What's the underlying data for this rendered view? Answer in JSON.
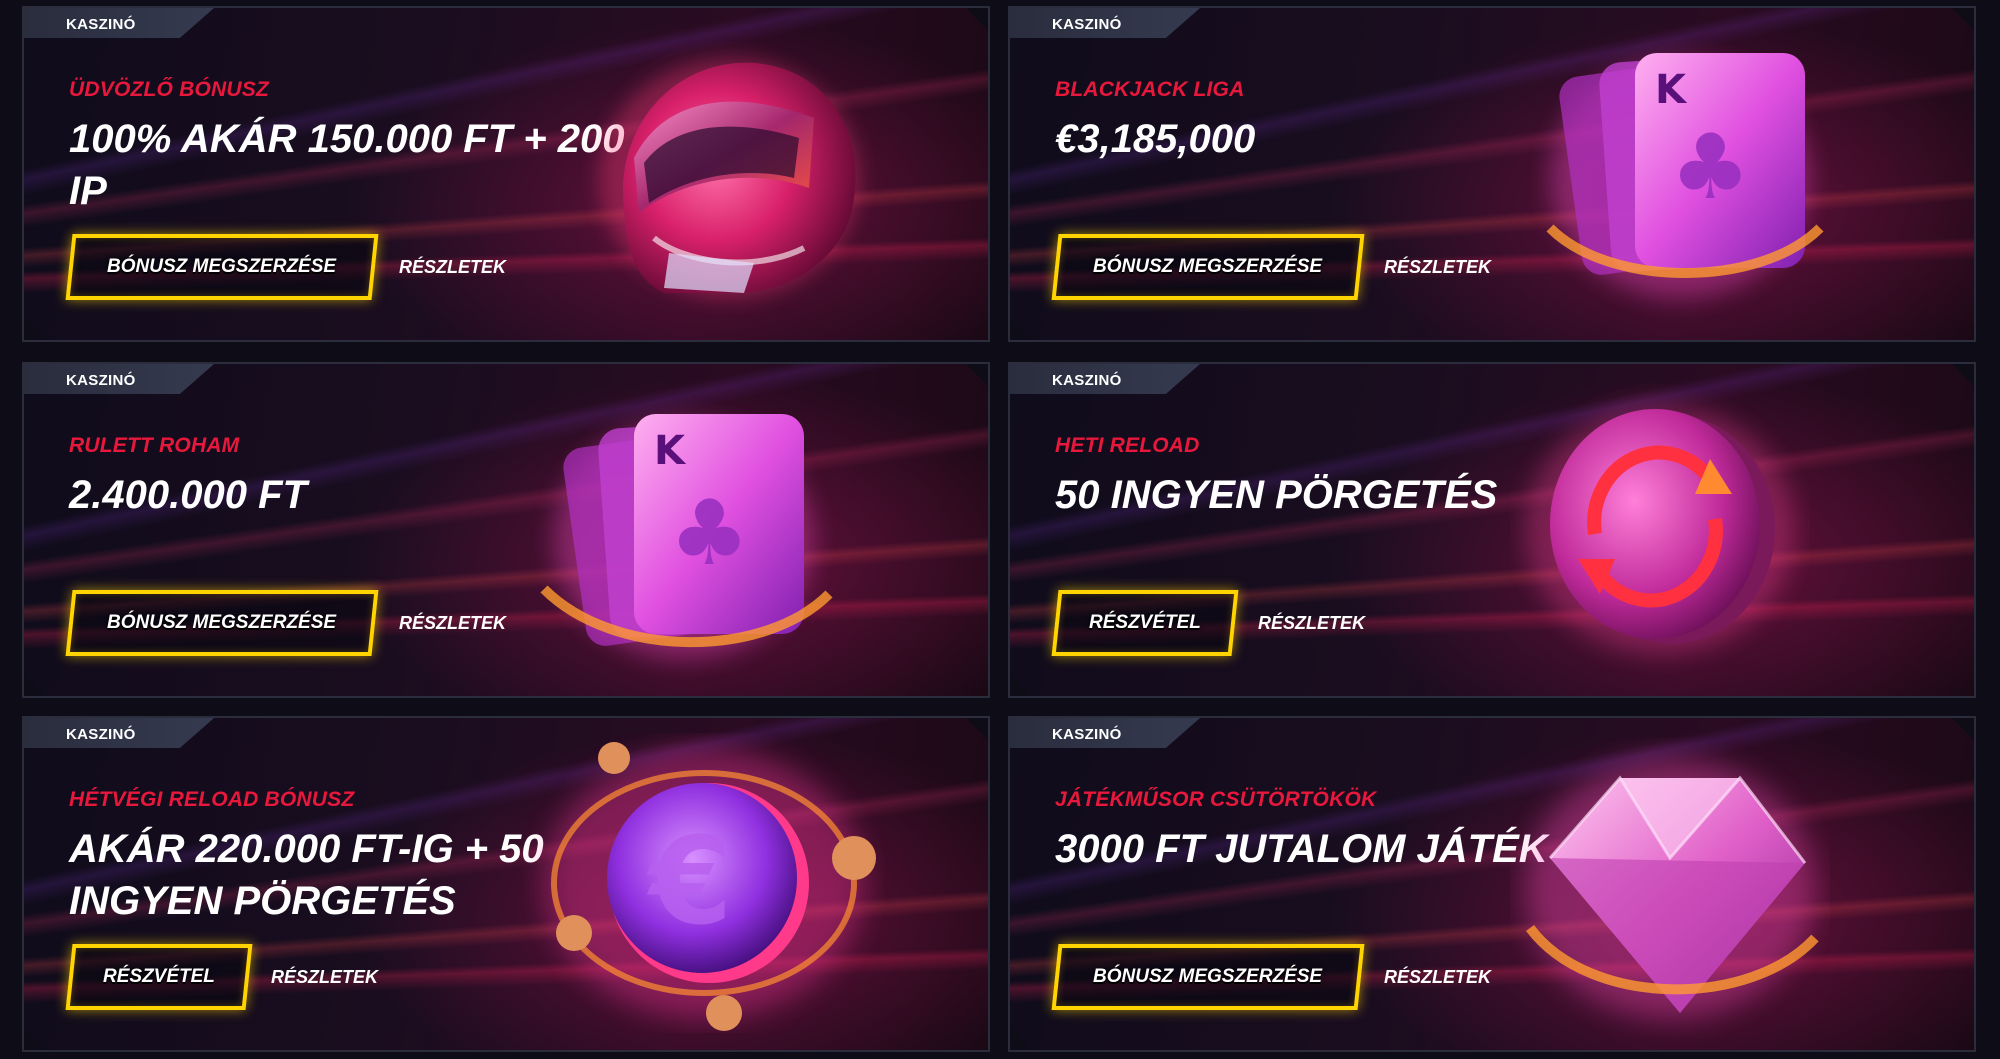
{
  "promos": [
    {
      "category": "KASZINÓ",
      "subtitle": "ÜDVÖZLŐ BÓNUSZ",
      "headline": "100% AKÁR 150.000 FT + 200 IP",
      "button_label": "BÓNUSZ MEGSZERZÉSE",
      "details_label": "RÉSZLETEK",
      "art": "helmet-icon"
    },
    {
      "category": "KASZINÓ",
      "subtitle": "BLACKJACK LIGA",
      "headline": "€3,185,000",
      "button_label": "BÓNUSZ MEGSZERZÉSE",
      "details_label": "RÉSZLETEK",
      "art": "playing-cards-icon"
    },
    {
      "category": "KASZINÓ",
      "subtitle": "RULETT ROHAM",
      "headline": "2.400.000 FT",
      "button_label": "BÓNUSZ MEGSZERZÉSE",
      "details_label": "RÉSZLETEK",
      "art": "playing-cards-icon"
    },
    {
      "category": "KASZINÓ",
      "subtitle": "HETI RELOAD",
      "headline": "50 INGYEN PÖRGETÉS",
      "button_label": "RÉSZVÉTEL",
      "details_label": "RÉSZLETEK",
      "art": "reload-coin-icon"
    },
    {
      "category": "KASZINÓ",
      "subtitle": "HÉTVÉGI RELOAD BÓNUSZ",
      "headline": "AKÁR 220.000 FT-IG + 50 INGYEN PÖRGETÉS",
      "button_label": "RÉSZVÉTEL",
      "details_label": "RÉSZLETEK",
      "art": "euro-coin-icon"
    },
    {
      "category": "KASZINÓ",
      "subtitle": "JÁTÉKMŰSOR CSÜTÖRTÖKÖK",
      "headline": "3000 FT JUTALOM JÁTÉK",
      "button_label": "BÓNUSZ MEGSZERZÉSE",
      "details_label": "RÉSZLETEK",
      "art": "diamond-icon"
    }
  ],
  "colors": {
    "accent_red": "#e8183d",
    "button_yellow": "#ffd400",
    "background": "#0d0c17"
  }
}
